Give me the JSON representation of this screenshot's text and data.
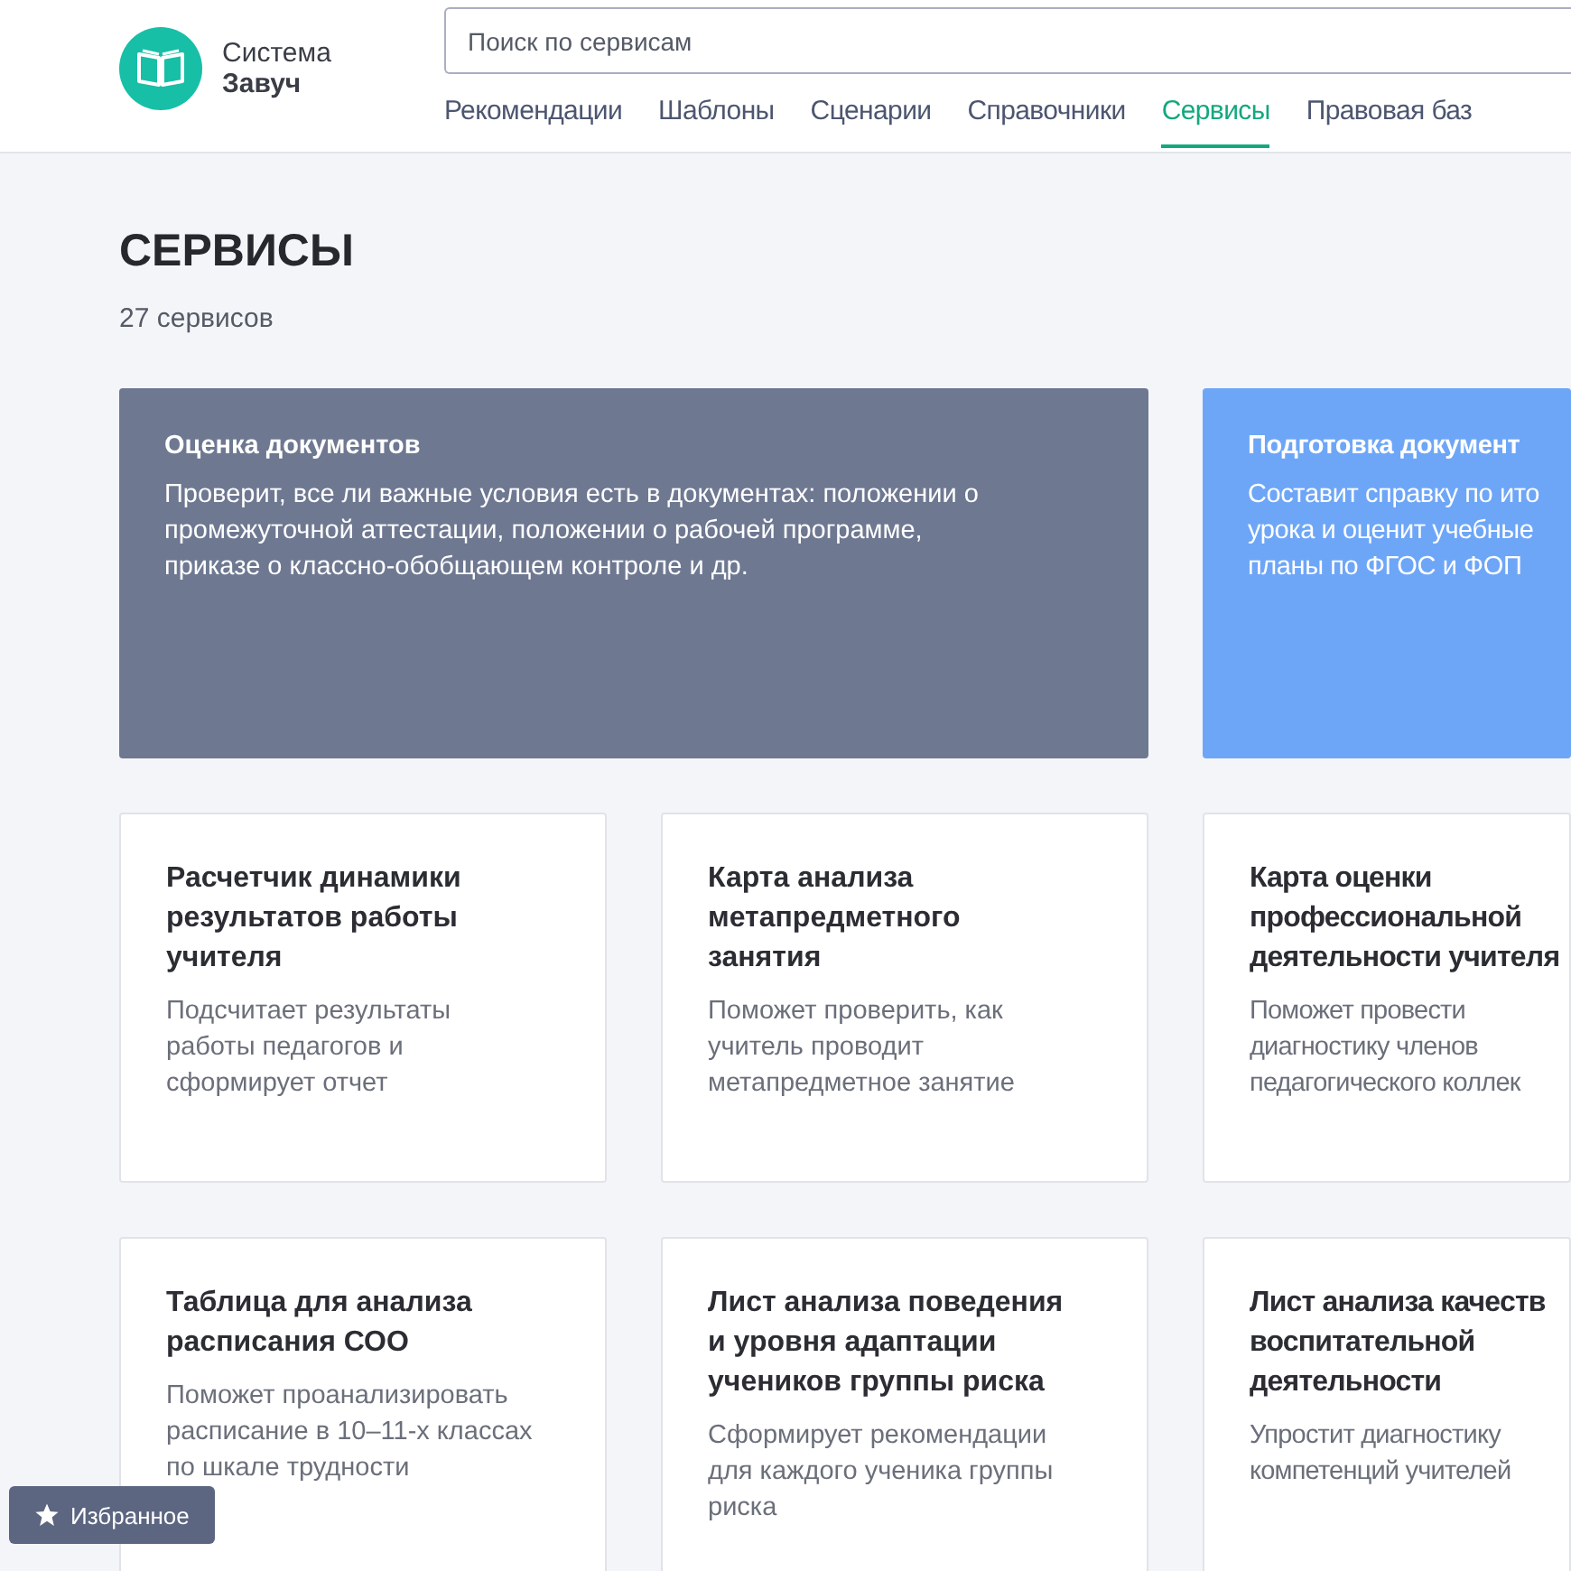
{
  "logo": {
    "line_1": "Система",
    "line_2": "Завуч"
  },
  "search": {
    "placeholder": "Поиск по сервисам"
  },
  "nav": [
    {
      "label": "Рекомендации",
      "selected": false
    },
    {
      "label": "Шаблоны",
      "selected": false
    },
    {
      "label": "Сценарии",
      "selected": false
    },
    {
      "label": "Справочники",
      "selected": false
    },
    {
      "label": "Сервисы",
      "selected": true
    },
    {
      "label": "Правовая баз",
      "selected": false
    }
  ],
  "page": {
    "title": "СЕРВИСЫ",
    "count": "27 сервисов"
  },
  "cards": [
    {
      "kind": "feature",
      "color": "#6e7891",
      "title": [
        "Оценка документов"
      ],
      "description": [
        "Проверит, все ли важные условия есть в документах: положении о",
        "промежуточной аттестации, положении о рабочей программе,",
        "приказе о классно-обобщающем контроле и др."
      ]
    },
    {
      "kind": "feature",
      "color": "#6ea6f7",
      "title": [
        "Подготовка документ"
      ],
      "description": [
        "Составит справку по ито",
        "урока и оценит учебные",
        "планы по ФГОС и ФОП"
      ]
    },
    {
      "kind": "tool",
      "title": [
        "Расчетчик динамики",
        "результатов работы",
        "учителя"
      ],
      "description": [
        "Подсчитает результаты",
        "работы педагогов и",
        "сформирует отчет"
      ]
    },
    {
      "kind": "tool",
      "title": [
        "Карта анализа",
        "метапредметного",
        "занятия"
      ],
      "description": [
        "Поможет проверить, как",
        "учитель проводит",
        "метапредметное занятие"
      ]
    },
    {
      "kind": "tool",
      "title": [
        "Карта оценки",
        "профессиональной",
        "деятельности учителя"
      ],
      "description": [
        "Поможет провести",
        "диагностику членов",
        "педагогического коллек"
      ]
    },
    {
      "kind": "tool",
      "title": [
        "Таблица для анализа",
        "расписания СОО"
      ],
      "description": [
        "Поможет проанализировать",
        "расписание в 10–11-х классах",
        "по шкале трудности"
      ]
    },
    {
      "kind": "tool",
      "title": [
        "Лист анализа поведения",
        "и уровня адаптации",
        "учеников группы риска"
      ],
      "description": [
        "Сформирует рекомендации",
        "для каждого ученика группы",
        "риска"
      ]
    },
    {
      "kind": "tool",
      "title": [
        "Лист анализа качеств",
        "воспитательной",
        "деятельности"
      ],
      "description": [
        "Упростит диагностику",
        "компетенций учителей"
      ]
    }
  ],
  "favorites_button": {
    "label": "Избранное"
  }
}
